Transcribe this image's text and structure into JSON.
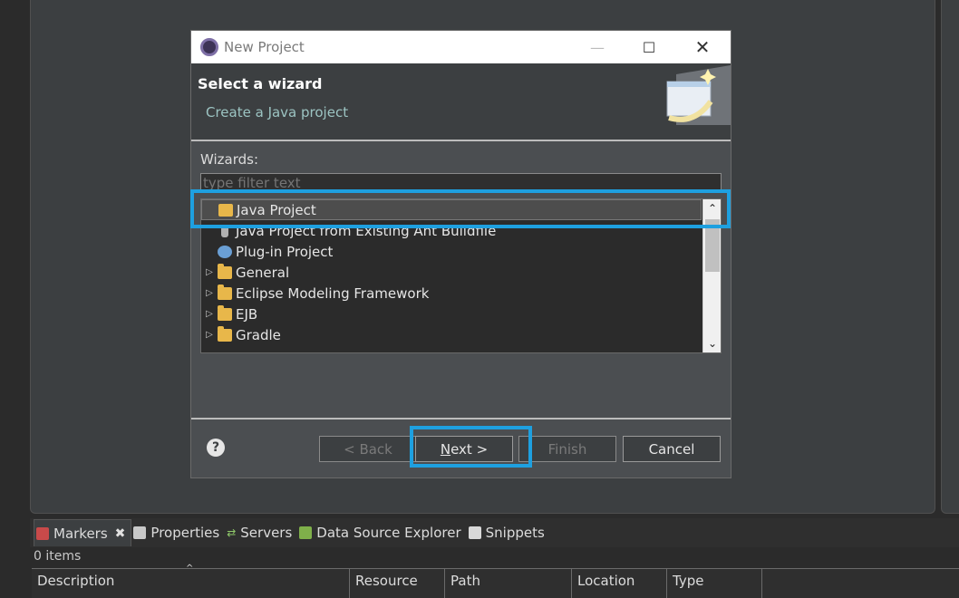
{
  "dialog": {
    "title": "New Project",
    "heading": "Select a wizard",
    "description": "Create a Java project",
    "wizards_label": "Wizards:",
    "filter_placeholder": "type filter text",
    "tree_items": [
      {
        "label": "Java Project",
        "expandable": false,
        "selected": true,
        "icon": "java-project-icon"
      },
      {
        "label": "Java Project from Existing Ant Buildfile",
        "expandable": false,
        "selected": false,
        "icon": "ant-icon"
      },
      {
        "label": "Plug-in Project",
        "expandable": false,
        "selected": false,
        "icon": "plugin-icon"
      },
      {
        "label": "General",
        "expandable": true,
        "selected": false,
        "icon": "folder-icon"
      },
      {
        "label": "Eclipse Modeling Framework",
        "expandable": true,
        "selected": false,
        "icon": "folder-icon"
      },
      {
        "label": "EJB",
        "expandable": true,
        "selected": false,
        "icon": "folder-icon"
      },
      {
        "label": "Gradle",
        "expandable": true,
        "selected": false,
        "icon": "folder-icon"
      }
    ],
    "buttons": {
      "back": "< Back",
      "next_prefix": "",
      "next_underlined": "N",
      "next_rest": "ext >",
      "finish": "Finish",
      "cancel": "Cancel",
      "help": "?"
    }
  },
  "bottom_panel": {
    "tabs": [
      {
        "label": "Markers",
        "active": true,
        "icon": "markers-icon"
      },
      {
        "label": "Properties",
        "active": false,
        "icon": "properties-icon"
      },
      {
        "label": "Servers",
        "active": false,
        "icon": "servers-icon"
      },
      {
        "label": "Data Source Explorer",
        "active": false,
        "icon": "data-source-icon"
      },
      {
        "label": "Snippets",
        "active": false,
        "icon": "snippets-icon"
      }
    ],
    "items_count": "0 items",
    "columns": [
      "Description",
      "Resource",
      "Path",
      "Location",
      "Type"
    ]
  },
  "colors": {
    "highlight": "#1ea0e0",
    "dialog_bg": "#4b4e51",
    "accent_text": "#9cc4c2"
  }
}
